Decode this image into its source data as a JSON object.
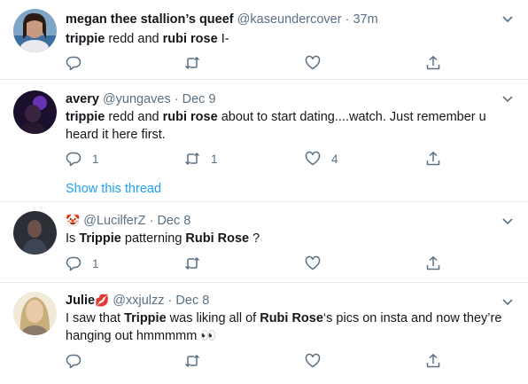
{
  "colors": {
    "accent": "#1da1f2",
    "secondary_text": "#5b7083",
    "border": "#e6ecf0"
  },
  "tweets": [
    {
      "display_name": "megan thee stallion’s queef",
      "handle": "@kaseundercover",
      "time": "37m",
      "text": {
        "p1": "trippie",
        "p2": " redd and ",
        "p3": "rubi rose",
        "p4": " I-"
      },
      "replies": "",
      "retweets": "",
      "likes": ""
    },
    {
      "display_name": "avery",
      "handle": "@yungaves",
      "time": "Dec 9",
      "text": {
        "p1": "trippie",
        "p2": " redd and ",
        "p3": "rubi rose",
        "p4": " about to start dating....watch. Just remember u heard it here first."
      },
      "replies": "1",
      "retweets": "1",
      "likes": "4",
      "show_thread": "Show this thread"
    },
    {
      "display_name": "🤡",
      "handle": "@LucilferZ",
      "time": "Dec 8",
      "text": {
        "p1": "Is ",
        "p2": "Trippie",
        "p3": " patterning ",
        "p4": "Rubi Rose",
        "p5": " ?"
      },
      "replies": "1",
      "retweets": "",
      "likes": ""
    },
    {
      "display_name": "Julie",
      "name_emoji": "💋",
      "handle": "@xxjulzz",
      "time": "Dec 8",
      "text": {
        "p1": "I saw that ",
        "p2": "Trippie",
        "p3": " was liking all of ",
        "p4": "Rubi Rose",
        "p5": "‘s pics on insta and now they’re hanging out hmmmmm 👀"
      },
      "replies": "",
      "retweets": "",
      "likes": ""
    }
  ],
  "icons": {
    "reply": "reply-icon",
    "retweet": "retweet-icon",
    "like": "heart-icon",
    "share": "share-icon",
    "caret": "chevron-down-icon"
  },
  "separator": "·"
}
